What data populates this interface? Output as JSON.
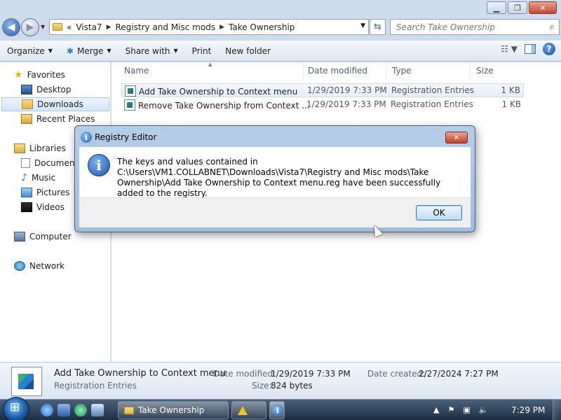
{
  "window": {
    "minimize": "▁",
    "maximize": "❐",
    "close": "✕"
  },
  "address": {
    "overflow": "«",
    "crumbs": [
      "Vista7",
      "Registry and Misc mods",
      "Take Ownership"
    ],
    "refresh_icon": "refresh-icon",
    "search_placeholder": "Search Take Ownership"
  },
  "toolbar": {
    "organize": "Organize",
    "merge": "Merge",
    "share_with": "Share with",
    "print": "Print",
    "new_folder": "New folder"
  },
  "nav": {
    "favorites": "Favorites",
    "desktop": "Desktop",
    "downloads": "Downloads",
    "recent_places": "Recent Places",
    "libraries": "Libraries",
    "documents": "Documents",
    "music": "Music",
    "pictures": "Pictures",
    "videos": "Videos",
    "computer": "Computer",
    "network": "Network"
  },
  "columns": {
    "name": "Name",
    "date_modified": "Date modified",
    "type": "Type",
    "size": "Size"
  },
  "files": [
    {
      "name": "Add Take Ownership to Context menu",
      "date": "1/29/2019 7:33 PM",
      "type": "Registration Entries",
      "size": "1 KB"
    },
    {
      "name": "Remove Take Ownership from Context ...",
      "date": "1/29/2019 7:33 PM",
      "type": "Registration Entries",
      "size": "1 KB"
    }
  ],
  "details": {
    "name": "Add Take Ownership to Context menu",
    "type": "Registration Entries",
    "date_modified_label": "Date modified:",
    "date_modified": "1/29/2019 7:33 PM",
    "size_label": "Size:",
    "size": "824 bytes",
    "date_created_label": "Date created:",
    "date_created": "2/27/2024 7:27 PM"
  },
  "dialog": {
    "title": "Registry Editor",
    "message": "The keys and values contained in C:\\Users\\VM1.COLLABNET\\Downloads\\Vista7\\Registry and Misc mods\\Take Ownership\\Add Take Ownership to Context menu.reg have been successfully added to the registry.",
    "ok": "OK",
    "close": "✕"
  },
  "taskbar": {
    "window_label": "Take Ownership",
    "clock": "7:29 PM"
  },
  "colors": {
    "accent": "#2d5fa8",
    "selection": "#d4e6fb"
  }
}
